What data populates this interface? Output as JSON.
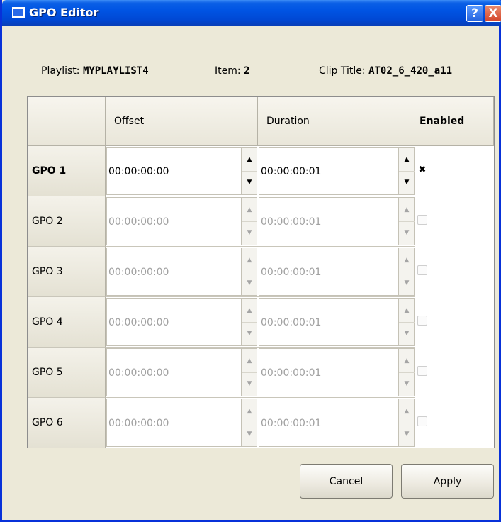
{
  "window": {
    "title": "GPO Editor",
    "help_glyph": "?",
    "close_glyph": "X"
  },
  "info": {
    "playlist_label": "Playlist:",
    "playlist_value": "MYPLAYLIST4",
    "item_label": "Item:",
    "item_value": "2",
    "clip_label": "Clip Title:",
    "clip_value": "AT02_6_420_a11"
  },
  "grid": {
    "headers": {
      "offset": "Offset",
      "duration": "Duration",
      "enabled": "Enabled"
    },
    "rows": [
      {
        "name": "GPO 1",
        "offset": "00:00:00:00",
        "duration": "00:00:00:01",
        "enabled": true
      },
      {
        "name": "GPO 2",
        "offset": "00:00:00:00",
        "duration": "00:00:00:01",
        "enabled": false
      },
      {
        "name": "GPO 3",
        "offset": "00:00:00:00",
        "duration": "00:00:00:01",
        "enabled": false
      },
      {
        "name": "GPO 4",
        "offset": "00:00:00:00",
        "duration": "00:00:00:01",
        "enabled": false
      },
      {
        "name": "GPO 5",
        "offset": "00:00:00:00",
        "duration": "00:00:00:01",
        "enabled": false
      },
      {
        "name": "GPO 6",
        "offset": "00:00:00:00",
        "duration": "00:00:00:01",
        "enabled": false
      }
    ],
    "check_glyph": "✖"
  },
  "buttons": {
    "cancel": "Cancel",
    "apply": "Apply"
  },
  "icons": {
    "window": "window-icon",
    "help": "help-icon",
    "close": "close-icon",
    "spin_up": "spin-up-icon",
    "spin_down": "spin-down-icon",
    "checkbox_checked": "checkmark-x-icon"
  },
  "colors": {
    "titlebar": "#0054e3",
    "face": "#ece9d8",
    "disabled_text": "#a0a0a0"
  }
}
